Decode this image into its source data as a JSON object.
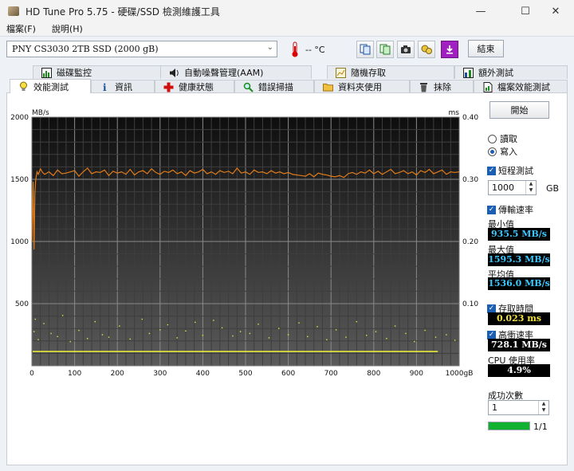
{
  "window": {
    "title": "HD Tune Pro 5.75 - 硬碟/SSD 檢測維護工具",
    "minimize": "—",
    "maximize": "☐",
    "close": "✕"
  },
  "menu": [
    {
      "label": "檔案(F)"
    },
    {
      "label": "說明(H)"
    }
  ],
  "toolbar": {
    "drive": "PNY CS3030 2TB SSD (2000 gB)",
    "temperature": "-- °C",
    "exit_label": "結束"
  },
  "tabs_row1": [
    {
      "label": "磁碟監控",
      "icon": "bar-chart-icon"
    },
    {
      "label": "自動噪聲管理(AAM)",
      "icon": "speaker-icon"
    },
    {
      "label": "隨機存取",
      "icon": "random-chart-icon"
    },
    {
      "label": "額外測試",
      "icon": "extra-chart-icon"
    }
  ],
  "tabs_row2": [
    {
      "label": "效能測試",
      "icon": "lightbulb-icon"
    },
    {
      "label": "資訊",
      "icon": "info-icon"
    },
    {
      "label": "健康狀態",
      "icon": "health-cross-icon"
    },
    {
      "label": "錯誤掃描",
      "icon": "magnifier-icon"
    },
    {
      "label": "資料夾使用",
      "icon": "folder-icon"
    },
    {
      "label": "抹除",
      "icon": "trash-icon"
    },
    {
      "label": "檔案效能測試",
      "icon": "file-benchmark-icon"
    }
  ],
  "controls": {
    "start_label": "開始",
    "read_label": "讀取",
    "write_label": "寫入",
    "selected_mode": "write",
    "short_test_label": "短程測試",
    "size_value": "1000",
    "size_unit": "GB",
    "transfer_rate_label": "傳輸速率",
    "min_label": "最小值",
    "min_value": "935.5 MB/s",
    "max_label": "最大值",
    "max_value": "1595.3 MB/s",
    "avg_label": "平均值",
    "avg_value": "1536.0 MB/s",
    "access_time_label": "存取時間",
    "access_time_value": "0.023 ms",
    "burst_rate_label": "高衝速率",
    "burst_rate_value": "728.1 MB/s",
    "cpu_label": "CPU 使用率",
    "cpu_value": "4.9%",
    "success_label": "成功次數",
    "success_value": "1",
    "progress_fraction": 1.0,
    "progress_text": "1/1",
    "progress_color": "#10b030"
  },
  "chart_data": {
    "type": "line",
    "ylabel_left": "MB/s",
    "ylabel_right": "ms",
    "xlabel": "gB",
    "xlim": [
      0,
      1000
    ],
    "ylim_left": [
      0,
      2000
    ],
    "ylim_right": [
      0,
      0.4
    ],
    "x_ticks": [
      "0",
      "100",
      "200",
      "300",
      "400",
      "500",
      "600",
      "700",
      "800",
      "900",
      "1000gB"
    ],
    "y_ticks_left": [
      "2000",
      "1500",
      "1000",
      "500"
    ],
    "y_ticks_right": [
      "0.40",
      "0.30",
      "0.20",
      "0.10"
    ],
    "grid": true,
    "series": [
      {
        "kind": "transfer",
        "color": "#e07b1a",
        "x": [
          0,
          3,
          5,
          7,
          9,
          12,
          15,
          20,
          25,
          30,
          40,
          50,
          60,
          70,
          80,
          90,
          100,
          110,
          120,
          130,
          140,
          150,
          160,
          170,
          180,
          190,
          200,
          210,
          220,
          230,
          240,
          250,
          260,
          270,
          280,
          290,
          300,
          310,
          320,
          330,
          340,
          350,
          360,
          370,
          380,
          390,
          400,
          410,
          420,
          430,
          440,
          450,
          460,
          470,
          480,
          490,
          500,
          510,
          520,
          530,
          540,
          550,
          560,
          570,
          580,
          590,
          600,
          610,
          620,
          630,
          640,
          650,
          660,
          670,
          680,
          690,
          700,
          710,
          720,
          730,
          740,
          750,
          760,
          770,
          780,
          790,
          800,
          810,
          820,
          830,
          840,
          850,
          860,
          870,
          880,
          890,
          900,
          910,
          920,
          930,
          940,
          950,
          960,
          970,
          980,
          990,
          1000
        ],
        "values": [
          1000,
          1480,
          935,
          1380,
          1500,
          1560,
          1540,
          1585,
          1555,
          1540,
          1560,
          1530,
          1575,
          1545,
          1550,
          1560,
          1570,
          1525,
          1560,
          1590,
          1545,
          1560,
          1555,
          1575,
          1530,
          1565,
          1550,
          1560,
          1540,
          1580,
          1535,
          1560,
          1570,
          1545,
          1585,
          1555,
          1540,
          1565,
          1555,
          1575,
          1545,
          1560,
          1530,
          1570,
          1550,
          1560,
          1580,
          1545,
          1560,
          1540,
          1570,
          1555,
          1565,
          1545,
          1590,
          1550,
          1560,
          1540,
          1575,
          1555,
          1560,
          1545,
          1570,
          1550,
          1560,
          1545,
          1555,
          1540,
          1535,
          1530,
          1525,
          1545,
          1520,
          1550,
          1540,
          1535,
          1525,
          1520,
          1530,
          1515,
          1545,
          1555,
          1540,
          1560,
          1550,
          1575,
          1545,
          1565,
          1540,
          1560,
          1580,
          1545,
          1555,
          1570,
          1545,
          1560,
          1535,
          1570,
          1555,
          1580,
          1545,
          1560,
          1575,
          1540,
          1560,
          1555,
          1560
        ]
      },
      {
        "kind": "access_time",
        "color": "#e8e83a",
        "unit": "ms",
        "baseline": 0.023,
        "outliers": [
          [
            5,
            0.055
          ],
          [
            8,
            0.075
          ],
          [
            15,
            0.042
          ],
          [
            28,
            0.068
          ],
          [
            45,
            0.052
          ],
          [
            60,
            0.047
          ],
          [
            72,
            0.081
          ],
          [
            90,
            0.039
          ],
          [
            110,
            0.057
          ],
          [
            130,
            0.044
          ],
          [
            148,
            0.071
          ],
          [
            165,
            0.05
          ],
          [
            180,
            0.046
          ],
          [
            205,
            0.064
          ],
          [
            230,
            0.043
          ],
          [
            258,
            0.075
          ],
          [
            275,
            0.052
          ],
          [
            300,
            0.058
          ],
          [
            318,
            0.066
          ],
          [
            340,
            0.045
          ],
          [
            360,
            0.056
          ],
          [
            382,
            0.07
          ],
          [
            400,
            0.049
          ],
          [
            425,
            0.073
          ],
          [
            445,
            0.061
          ],
          [
            470,
            0.048
          ],
          [
            488,
            0.055
          ],
          [
            510,
            0.052
          ],
          [
            530,
            0.067
          ],
          [
            555,
            0.045
          ],
          [
            578,
            0.06
          ],
          [
            600,
            0.05
          ],
          [
            625,
            0.069
          ],
          [
            645,
            0.047
          ],
          [
            668,
            0.063
          ],
          [
            690,
            0.042
          ],
          [
            712,
            0.058
          ],
          [
            735,
            0.046
          ],
          [
            760,
            0.071
          ],
          [
            783,
            0.049
          ],
          [
            805,
            0.055
          ],
          [
            830,
            0.044
          ],
          [
            850,
            0.064
          ],
          [
            875,
            0.052
          ],
          [
            895,
            0.039
          ],
          [
            920,
            0.057
          ],
          [
            945,
            0.046
          ],
          [
            970,
            0.05
          ],
          [
            990,
            0.041
          ]
        ]
      }
    ]
  }
}
